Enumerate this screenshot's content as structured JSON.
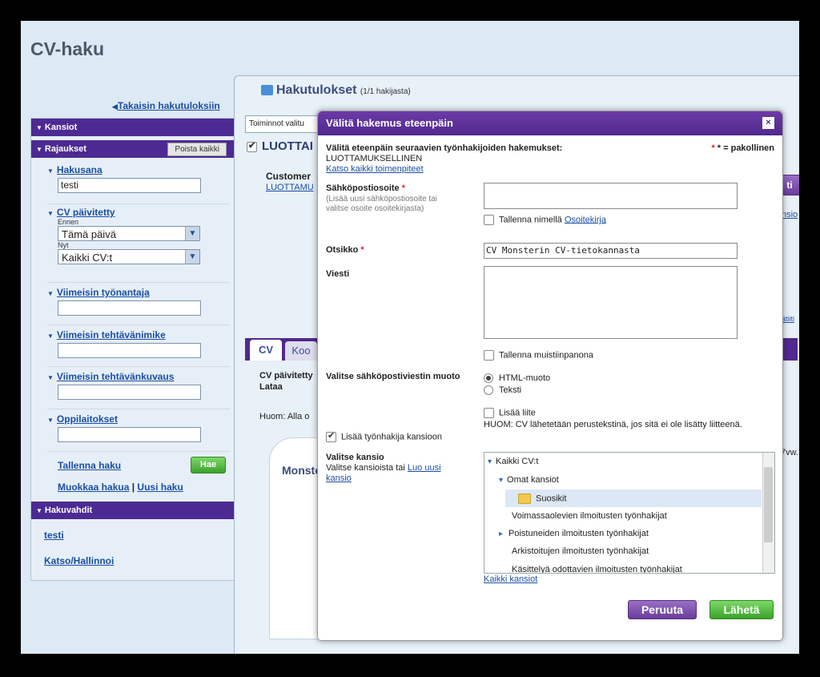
{
  "page": {
    "title": "CV-haku"
  },
  "sidebar": {
    "back_link": "Takaisin hakutuloksiin",
    "folders_header": "Kansiot",
    "filters_header": "Rajaukset",
    "clear_all": "Poista kaikki",
    "keyword": {
      "label": "Hakusana",
      "value": "testi"
    },
    "cv_updated": {
      "label": "CV päivitetty",
      "before_label": "Ennen",
      "before_value": "Tämä päivä",
      "now_label": "Nyt",
      "now_value": "Kaikki CV:t"
    },
    "last_employer": {
      "label": "Viimeisin työnantaja",
      "value": ""
    },
    "last_title": {
      "label": "Viimeisin tehtävänimike",
      "value": ""
    },
    "last_description": {
      "label": "Viimeisin tehtävänkuvaus",
      "value": ""
    },
    "schools": {
      "label": "Oppilaitokset",
      "value": ""
    },
    "save_search": "Tallenna haku",
    "search_button": "Hae",
    "edit_search": "Muokkaa hakua",
    "separator": "|",
    "new_search": "Uusi haku",
    "alerts_header": "Hakuvahdit",
    "alert_item": "testi",
    "manage": "Katso/Hallinnoi"
  },
  "results": {
    "title": "Hakutulokset",
    "count": "(1/1 hakijasta)",
    "actions_select": "Toiminnot valitu",
    "candidate": "LUOTTAI",
    "customer_label": "Customer",
    "customer_link": "LUOTTAMU",
    "tab_cv": "CV",
    "tab_other": "Koo",
    "cv_updated": "CV päivitetty",
    "download": "Lataa",
    "note": "Huom: Alla o",
    "monster": "Monste",
    "right_btn": "ti",
    "right_link1": "nsio",
    "right_link2": "ätiiti",
    "right_text": "7vw."
  },
  "modal": {
    "title": "Välitä hakemus eteenpäin",
    "close": "×",
    "intro": "Välitä eteenpäin seuraavien työnhakijoiden hakemukset:",
    "required_note": "* = pakollinen",
    "candidate": "LUOTTAMUKSELLINEN",
    "view_actions": "Katso kaikki toimenpiteet",
    "email_label": "Sähköpostiosoite",
    "email_hint": "(Lisää uusi sähköpostiosoite tai valitse osoite osoitekirjasta)",
    "email_value": "",
    "save_name": "Tallenna nimellä",
    "address_book": "Osoitekirja",
    "subject_label": "Otsikko",
    "subject_value": "CV Monsterin CV-tietokannasta",
    "message_label": "Viesti",
    "message_value": "",
    "save_note": "Tallenna muistiinpanona",
    "format_label": "Valitse sähköpostiviestin muoto",
    "format_html": "HTML-muoto",
    "format_text": "Teksti",
    "attach_label": "Lisää liite",
    "attach_note": "HUOM: CV lähetetään perustekstinä, jos sitä ei ole lisätty liitteenä.",
    "add_to_folder": "Lisää työnhakija kansioon",
    "folder_label": "Valitse kansio",
    "folder_hint": "Valitse kansioista tai",
    "create_folder": "Luo uusi kansio",
    "tree": [
      {
        "label": "Kaikki CV:t",
        "marker": "▾"
      },
      {
        "label": "Omat kansiot",
        "marker": "▾"
      },
      {
        "label": "Suosikit",
        "marker": ""
      },
      {
        "label": "Voimassaolevien ilmoitusten työnhakijat",
        "marker": ""
      },
      {
        "label": "Poistuneiden ilmoitusten työnhakijat",
        "marker": "▸"
      },
      {
        "label": "Arkistoitujen ilmoitusten työnhakijat",
        "marker": ""
      },
      {
        "label": "Käsittelyä odottavien ilmoitusten työnhakijat",
        "marker": ""
      }
    ],
    "all_folders": "Kaikki kansiot",
    "cancel": "Peruuta",
    "send": "Lähetä"
  },
  "colors": {
    "purple": "#512a8d",
    "green": "#3aa22a",
    "link": "#1a4fa3"
  }
}
